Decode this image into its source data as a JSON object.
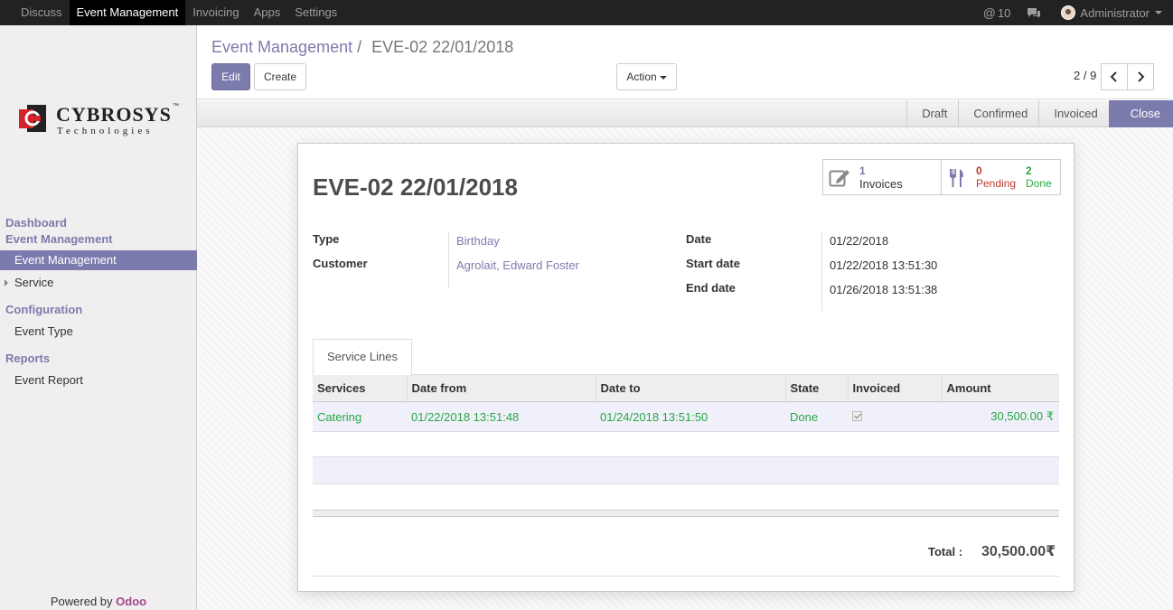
{
  "topbar": {
    "menu": [
      "Discuss",
      "Event Management",
      "Invoicing",
      "Apps",
      "Settings"
    ],
    "active_index": 1,
    "messages_count": "10",
    "user": "Administrator"
  },
  "logo": {
    "brand": "CYBROSYS",
    "tm": "™",
    "sub": "Technologies"
  },
  "sidebar": {
    "dashboard": "Dashboard",
    "event_management_head": "Event Management",
    "event_management_item": "Event Management",
    "service": "Service",
    "configuration": "Configuration",
    "event_type": "Event Type",
    "reports": "Reports",
    "event_report": "Event Report",
    "powered_by": "Powered by",
    "odoo": "Odoo"
  },
  "control_panel": {
    "breadcrumb_parent": "Event Management",
    "breadcrumb_sep": "/",
    "breadcrumb_current": "EVE-02 22/01/2018",
    "edit_label": "Edit",
    "create_label": "Create",
    "action_label": "Action",
    "pager": "2 / 9"
  },
  "statusbar": {
    "stages": [
      "Draft",
      "Confirmed",
      "Invoiced",
      "Close"
    ],
    "selected_index": 3
  },
  "smart_buttons": {
    "invoices_count": "1",
    "invoices_label": "Invoices",
    "pending_count": "0",
    "pending_label": "Pending",
    "done_count": "2",
    "done_label": "Done"
  },
  "record": {
    "title": "EVE-02 22/01/2018",
    "type_label": "Type",
    "type_value": "Birthday",
    "customer_label": "Customer",
    "customer_value": "Agrolait, Edward Foster",
    "date_label": "Date",
    "date_value": "01/22/2018",
    "start_label": "Start date",
    "start_value": "01/22/2018 13:51:30",
    "end_label": "End date",
    "end_value": "01/26/2018 13:51:38"
  },
  "tab": {
    "label": "Service Lines"
  },
  "table": {
    "headers": [
      "Services",
      "Date from",
      "Date to",
      "State",
      "Invoiced",
      "Amount"
    ],
    "row": {
      "service": "Catering",
      "date_from": "01/22/2018 13:51:48",
      "date_to": "01/24/2018 13:51:50",
      "state": "Done",
      "invoiced": true,
      "amount": "30,500.00 ₹"
    }
  },
  "total": {
    "label": "Total :",
    "value": "30,500.00₹"
  },
  "colors": {
    "accent": "#7c7bad",
    "success": "#28a745",
    "danger": "#c0392b",
    "topbar": "#222222"
  }
}
